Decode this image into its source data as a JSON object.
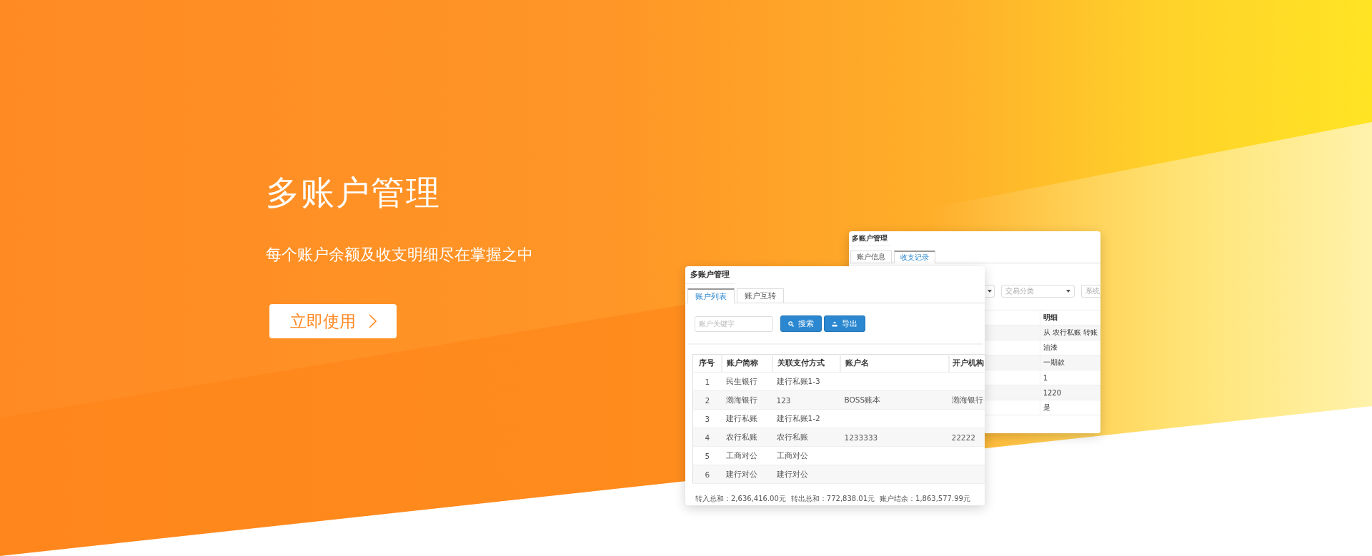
{
  "hero": {
    "title": "多账户管理",
    "subtitle": "每个账户余额及收支明细尽在掌握之中",
    "button": "立即使用"
  },
  "records_window": {
    "title": "多账户管理",
    "tabs": [
      {
        "label": "账户信息",
        "selected": false
      },
      {
        "label": "收支记录",
        "selected": true
      }
    ],
    "filters": [
      {
        "kind": "dropdown"
      },
      {
        "kind": "dropdown",
        "placeholder": "交易分类"
      },
      {
        "kind": "dropdown",
        "placeholder": "系统"
      }
    ],
    "table": {
      "columns": [
        "明细"
      ],
      "rows": [
        [
          "从 农行私账 转账"
        ],
        [
          "油漆"
        ],
        [
          "一期款"
        ],
        [
          "1"
        ],
        [
          "1220"
        ],
        [
          "是"
        ]
      ]
    }
  },
  "list_window": {
    "title": "多账户管理",
    "tabs": [
      {
        "label": "账户列表",
        "selected": true
      },
      {
        "label": "账户互转",
        "selected": false
      }
    ],
    "search": {
      "placeholder": "账户关键字"
    },
    "buttons": [
      {
        "label": "搜索",
        "kind": "search"
      },
      {
        "label": "导出",
        "kind": "export"
      }
    ],
    "table": {
      "columns": [
        "序号",
        "账户简称",
        "关联支付方式",
        "账户名",
        "开户机构"
      ],
      "rows": [
        {
          "index": "1",
          "short_name": "民生银行",
          "payment_method": "建行私账1-3"
        },
        {
          "index": "2",
          "short_name": "渤海银行",
          "payment_method": "123",
          "account_name": "BOSS账本",
          "bank": "渤海银行"
        },
        {
          "index": "3",
          "short_name": "建行私账",
          "payment_method": "建行私账1-2"
        },
        {
          "index": "4",
          "short_name": "农行私账",
          "payment_method": "农行私账",
          "account_name": "1233333",
          "bank": "22222"
        },
        {
          "index": "5",
          "short_name": "工商对公",
          "payment_method": "工商对公"
        },
        {
          "index": "6",
          "short_name": "建行对公",
          "payment_method": "建行对公"
        }
      ]
    },
    "totals": [
      "转入总和：2,636,416.00元",
      "转出总和：772,838.01元",
      "账户结余：1,863,577.99元"
    ]
  }
}
